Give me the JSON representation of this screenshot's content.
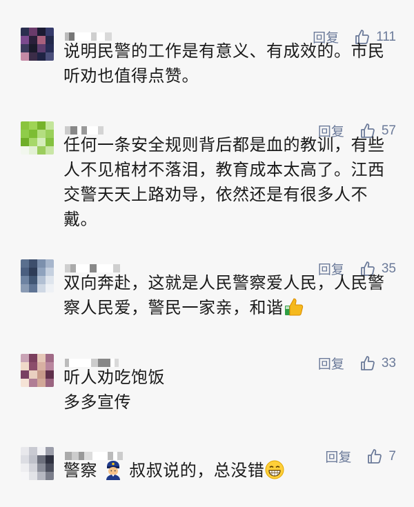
{
  "comments": [
    {
      "avatar": [
        "#2b2f4f",
        "#6a3b6b",
        "#1b1b33",
        "#353a6a",
        "#7b4a8e",
        "#2a1f3a",
        "#a8607d",
        "#22284a",
        "#3c3a5c",
        "#1a1a2a",
        "#5d3d6e",
        "#262c55",
        "#c58aa6",
        "#3b2c48",
        "#1f2344",
        "#4a4e7a"
      ],
      "nick_blocks": [
        [
          "#bbbbbb",
          6
        ],
        [
          "#777777",
          8
        ],
        [
          "#ffffff",
          24
        ],
        [
          "#cfcfcf",
          8
        ],
        [
          "#ffffff",
          12
        ],
        [
          "#d9d9d9",
          10
        ]
      ],
      "reply_label": "回复",
      "like_count": "111",
      "text": "说明民警的工作是有意义、有成效的。市民听劝也值得点赞。"
    },
    {
      "avatar": [
        "#8ac43d",
        "#9fd455",
        "#76b32b",
        "#c3e59a",
        "#8fcc4a",
        "#7dbd34",
        "#b4de80",
        "#9ad05a",
        "#6fae29",
        "#a7d86a",
        "#d5edbc",
        "#84c140",
        "#f2f7ee",
        "#e3f1d5",
        "#9ccd5e",
        "#c9e6a6"
      ],
      "nick_blocks": [
        [
          "#cccccc",
          8
        ],
        [
          "#888888",
          10
        ],
        [
          "#ffffff",
          6
        ],
        [
          "#999999",
          8
        ],
        [
          "#ffffff",
          16
        ],
        [
          "#d4d4d4",
          8
        ]
      ],
      "reply_label": "回复",
      "like_count": "57",
      "text": "任何一条安全规则背后都是血的教训，有些人不见棺材不落泪，教育成本太高了。江西交警天天上路劝导，依然还是有很多人不戴。"
    },
    {
      "avatar": [
        "#5a6f8e",
        "#3d4e6c",
        "#7c90ad",
        "#a7b6cc",
        "#4b5f80",
        "#2e3c57",
        "#8fa2bd",
        "#c5d0df",
        "#6e83a2",
        "#415674",
        "#b2c0d3",
        "#dfe5ed",
        "#8a9bb4",
        "#5f7494",
        "#cfd8e4",
        "#eef1f5"
      ],
      "nick_blocks": [
        [
          "#cfcfcf",
          8
        ],
        [
          "#aaaaaa",
          8
        ],
        [
          "#ffffff",
          20
        ],
        [
          "#888888",
          10
        ],
        [
          "#ffffff",
          24
        ],
        [
          "#cfcfcf",
          10
        ]
      ],
      "reply_label": "回复",
      "like_count": "35",
      "text": "双向奔赴，这就是人民警察爱人民，人民警察人民爱，警民一家亲，和谐"
    },
    {
      "avatar": [
        "#c9a3b5",
        "#7b3f5e",
        "#e5c7b7",
        "#a06a86",
        "#f0d9c9",
        "#8c4d6b",
        "#d8b0a2",
        "#b9869e",
        "#7a4063",
        "#e9cfc0",
        "#c79a8a",
        "#5f2f4a",
        "#f5e3d6",
        "#b07e95",
        "#d1a898",
        "#9a6480"
      ],
      "nick_blocks": [
        [
          "#bbbbbb",
          6
        ],
        [
          "#ffffff",
          32
        ],
        [
          "#cccccc",
          10
        ],
        [
          "#888888",
          18
        ],
        [
          "#ffffff",
          6
        ],
        [
          "#d9d9d9",
          6
        ]
      ],
      "reply_label": "回复",
      "like_count": "33",
      "text": "听人劝吃饱饭\n多多宣传"
    },
    {
      "avatar": [
        "#e8e8ec",
        "#c9cad2",
        "#f2f2f5",
        "#9c9eaa",
        "#dcdde3",
        "#bfc1ca",
        "#6c6f7c",
        "#2f3140",
        "#eeeef1",
        "#d3d4db",
        "#8a8d99",
        "#4a4d5c",
        "#f6f6f8",
        "#e2e3e8",
        "#b6b8c2",
        "#7b7e8b"
      ],
      "nick_blocks": [
        [
          "#aaaaaa",
          10
        ],
        [
          "#cccccc",
          10
        ],
        [
          "#999999",
          8
        ],
        [
          "#dddddd",
          12
        ],
        [
          "#ffffff",
          22
        ],
        [
          "#bbbbbb",
          8
        ],
        [
          "#ffffff",
          6
        ],
        [
          "#cccccc",
          8
        ]
      ],
      "reply_label": "回复",
      "like_count": "7",
      "text_before": "警察",
      "text_after": "叔叔说的，总没错"
    }
  ]
}
